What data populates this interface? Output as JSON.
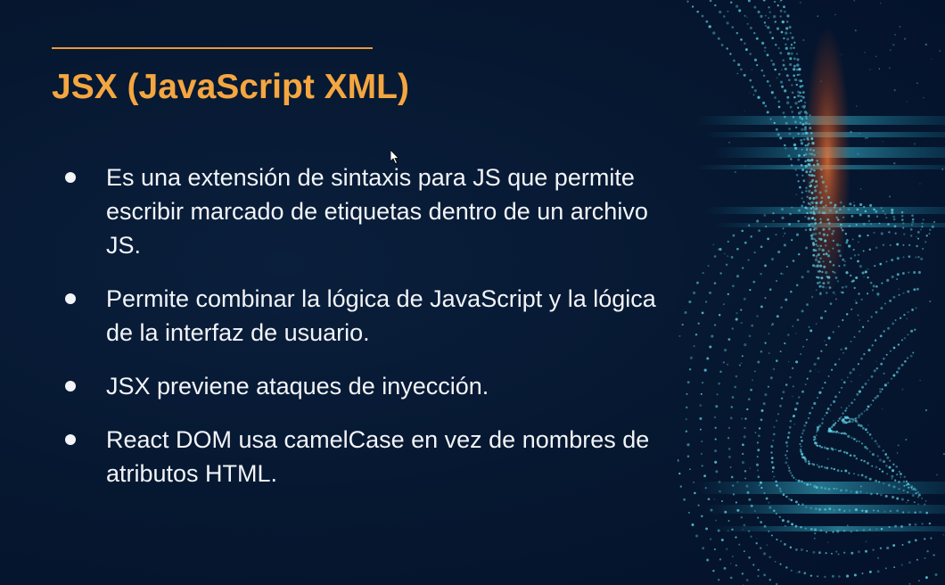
{
  "slide": {
    "title": "JSX (JavaScript XML)",
    "bullets": [
      "Es una extensión de sintaxis para JS que permite escribir marcado de etiquetas dentro de un archivo JS.",
      "Permite combinar la lógica de JavaScript y la lógica de la interfaz de usuario.",
      "JSX previene ataques de inyección.",
      "React DOM usa camelCase en vez de nombres de atributos HTML."
    ]
  },
  "colors": {
    "background": "#061730",
    "title": "#f4a640",
    "accent_rule": "#e89a3c",
    "text": "#f2f4f7",
    "decor_teal": "#5fd4e8",
    "decor_glow": "#e8652a"
  },
  "icons": {
    "bullet": "filled-circle",
    "pointer": "mouse-pointer-icon",
    "decoration": "particle-wave-graphic"
  }
}
